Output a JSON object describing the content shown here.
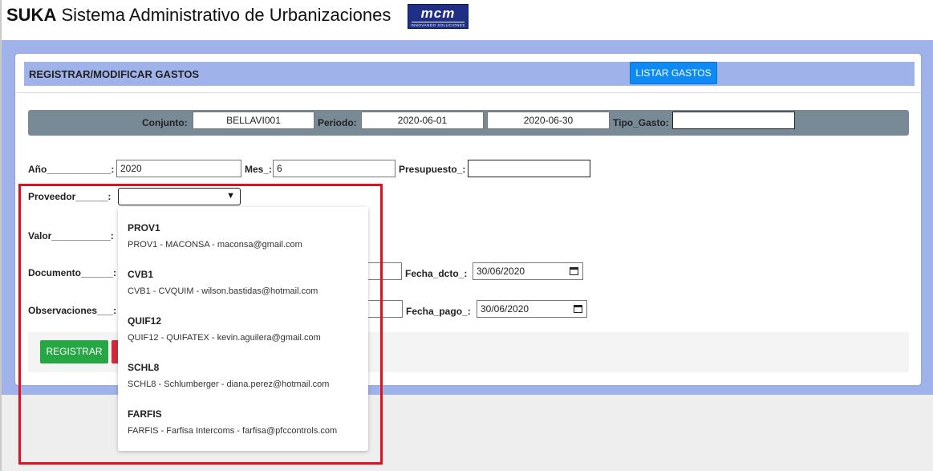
{
  "app": {
    "brand": "SUKA",
    "title": "Sistema Administrativo de Urbanizaciones",
    "logo_text": "mcm",
    "logo_tagline": "INNOVANDO SOLUCIONES"
  },
  "card": {
    "title": "REGISTRAR/MODIFICAR GASTOS",
    "list_button": "LISTAR GASTOS"
  },
  "filters": {
    "conjunto_label": "Conjunto:",
    "conjunto_value": "BELLAVI001",
    "periodo_label": "Periodo:",
    "periodo_start": "2020-06-01",
    "periodo_end": "2020-06-30",
    "tipo_gasto_label": "Tipo_Gasto:",
    "tipo_gasto_value": ""
  },
  "form": {
    "anio_label": "Año____________:",
    "anio_value": "2020",
    "mes_label": "Mes_:",
    "mes_value": "6",
    "presupuesto_label": "Presupuesto_:",
    "presupuesto_value": "",
    "proveedor_label": "Proveedor______:",
    "proveedor_value": "",
    "valor_label": "Valor___________:",
    "documento_label": "Documento______:",
    "fecha_dcto_label": "Fecha_dcto_:",
    "fecha_dcto_value": "30/06/2020",
    "observaciones_label": "Observaciones___:",
    "fecha_pago_label": "Fecha_pago_:",
    "fecha_pago_value": "30/06/2020",
    "register_button": "REGISTRAR"
  },
  "dropdown": {
    "options": [
      {
        "code": "PROV1",
        "detail": "PROV1 - MACONSA - maconsa@gmail.com"
      },
      {
        "code": "CVB1",
        "detail": "CVB1 - CVQUIM - wilson.bastidas@hotmail.com"
      },
      {
        "code": "QUIF12",
        "detail": "QUIF12 - QUIFATEX - kevin.aguilera@gmail.com"
      },
      {
        "code": "SCHL8",
        "detail": "SCHL8 - Schlumberger - diana.perez@hotmail.com"
      },
      {
        "code": "FARFIS",
        "detail": "FARFIS - Farfisa Intercoms - farfisa@pfccontrols.com"
      }
    ]
  },
  "colors": {
    "accent_blue": "#0d8af4",
    "band_blue": "#9fb3ea",
    "success_green": "#26a744",
    "danger_red": "#d8283a",
    "highlight_red": "#e01020"
  },
  "icons": {
    "select_arrow": "chevron-down-icon",
    "date_picker": "calendar-icon"
  }
}
